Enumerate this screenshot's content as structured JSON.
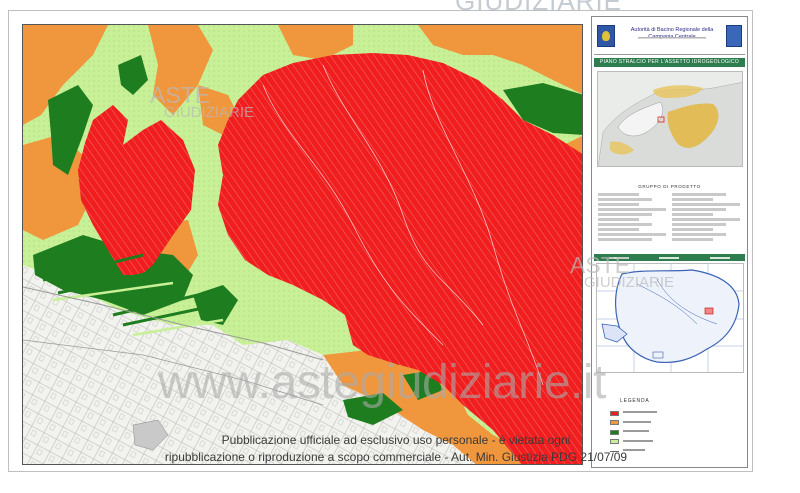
{
  "watermarks": {
    "top": "GIUDIZIARIE",
    "aste_word": "ASTE",
    "aste_sub": "GIUDIZIARIE",
    "site": "www.astegiudiziarie.it"
  },
  "notice": {
    "line1": "Pubblicazione ufficiale ad esclusivo uso personale - è vietata ogni",
    "line2": "ripubblicazione o riproduzione a scopo commerciale - Aut. Min. Giustizia PDG 21/07/09"
  },
  "title_block": {
    "authority": "Autorità di Bacino Regionale della Campania Centrale",
    "plan_title": "PIANO STRALCIO PER L'ASSETTO IDROGEOLOGICO",
    "group_title": "GRUPPO DI PROGETTO",
    "legend_title": "LEGENDA"
  },
  "colors": {
    "very_high": "#f01e1e",
    "high": "#f0963c",
    "medium": "#1e7d1e",
    "moderate": "#c8f096",
    "urban_bg": "#f2f2ee",
    "frame_green": "#2e7d4f"
  },
  "legend": [
    {
      "swatch": "#f01e1e"
    },
    {
      "swatch": "#f0963c"
    },
    {
      "swatch": "#1e7d1e"
    },
    {
      "swatch": "#c8f096"
    },
    {
      "swatch": "line"
    }
  ]
}
